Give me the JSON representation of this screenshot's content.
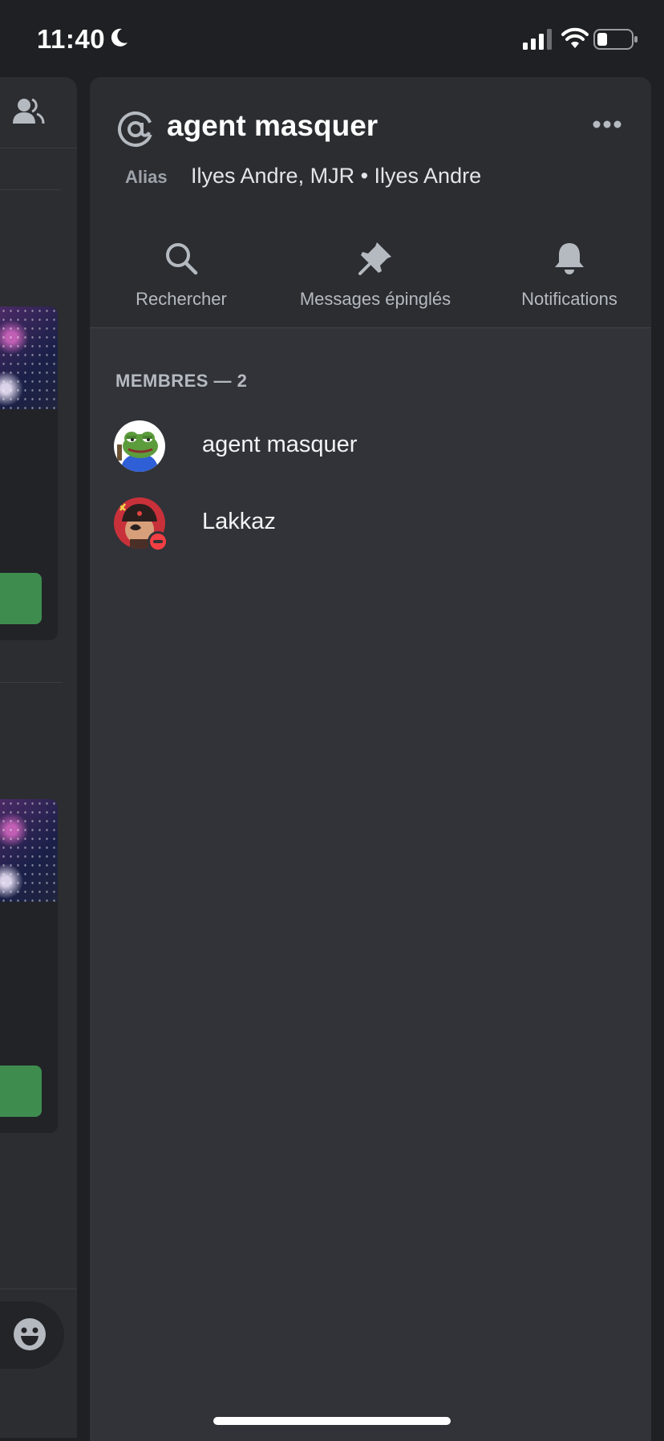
{
  "status_bar": {
    "time": "11:40",
    "icons": [
      "moon-icon",
      "signal-icon",
      "wifi-icon",
      "battery-icon"
    ]
  },
  "panel": {
    "title": "agent masquer",
    "alias_label": "Alias",
    "alias_value": "Ilyes Andre, MJR • Ilyes Andre",
    "actions": [
      {
        "label": "Rechercher",
        "icon": "search-icon"
      },
      {
        "label": "Messages épinglés",
        "icon": "pin-icon"
      },
      {
        "label": "Notifications",
        "icon": "bell-icon"
      }
    ],
    "members_header": "MEMBRES — 2",
    "members": [
      {
        "name": "agent masquer",
        "status": "none"
      },
      {
        "name": "Lakkaz",
        "status": "do-not-disturb"
      }
    ]
  },
  "colors": {
    "background": "#1f2023",
    "panel": "#313338",
    "header": "#2b2d31",
    "muted_text": "#b5bac1",
    "dnd": "#f23f43",
    "accent_green": "#3e8d4f"
  }
}
